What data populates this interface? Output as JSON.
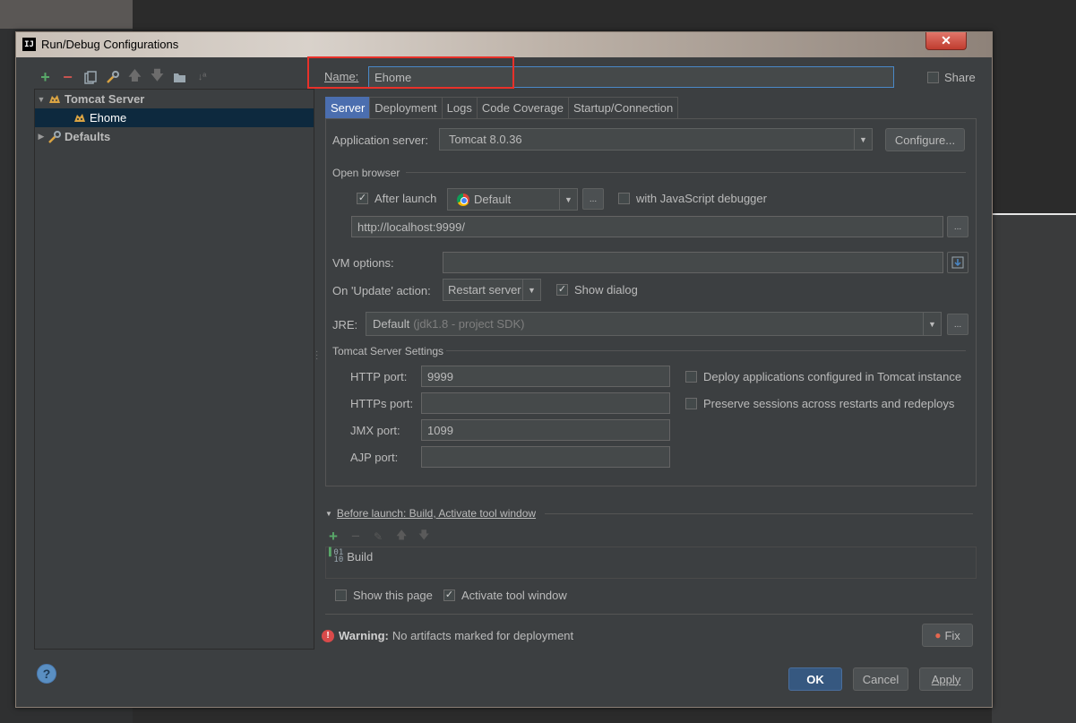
{
  "window": {
    "title": "Run/Debug Configurations",
    "close_label": "✕",
    "app_icon_label": "IJ"
  },
  "left_toolbar": {
    "icons": [
      "add-icon",
      "remove-icon",
      "copy-icon",
      "edit-defaults-icon",
      "move-up-icon",
      "move-down-icon",
      "folder-icon",
      "sort-icon"
    ]
  },
  "tree": {
    "items": [
      {
        "label": "Tomcat Server",
        "expanded": true
      },
      {
        "label": "Ehome",
        "selected": true
      },
      {
        "label": "Defaults",
        "expanded": false
      }
    ]
  },
  "name_field": {
    "label": "Name:",
    "value": "Ehome"
  },
  "share_label": "Share",
  "tabs": [
    "Server",
    "Deployment",
    "Logs",
    "Code Coverage",
    "Startup/Connection"
  ],
  "server": {
    "app_server_label": "Application server:",
    "app_server_value": "Tomcat 8.0.36",
    "configure_label": "Configure...",
    "open_browser_label": "Open browser",
    "after_launch_label": "After launch",
    "browser_value": "Default",
    "js_debugger_label": "with JavaScript debugger",
    "url_value": "http://localhost:9999/",
    "vm_options_label": "VM options:",
    "vm_options_value": "",
    "on_update_label": "On 'Update' action:",
    "on_update_value": "Restart server",
    "show_dialog_label": "Show dialog",
    "jre_label": "JRE:",
    "jre_value": "Default",
    "jre_hint": "(jdk1.8 - project SDK)",
    "tomcat_settings_label": "Tomcat Server Settings",
    "http_port_label": "HTTP port:",
    "http_port_value": "9999",
    "https_port_label": "HTTPs port:",
    "https_port_value": "",
    "jmx_port_label": "JMX port:",
    "jmx_port_value": "1099",
    "ajp_port_label": "AJP port:",
    "ajp_port_value": "",
    "deploy_apps_label": "Deploy applications configured in Tomcat instance",
    "preserve_sessions_label": "Preserve sessions across restarts and redeploys",
    "ellipsis": "..."
  },
  "before_launch": {
    "header": "Before launch: Build, Activate tool window",
    "items": [
      "Build"
    ],
    "show_page_label": "Show this page",
    "activate_tool_label": "Activate tool window"
  },
  "warning": {
    "bold": "Warning:",
    "text": "No artifacts marked for deployment",
    "fix_label": "Fix"
  },
  "footer": {
    "help_label": "?",
    "ok_label": "OK",
    "cancel_label": "Cancel",
    "apply_label": "Apply"
  },
  "colors": {
    "accent_tab": "#4b6eaf",
    "selection": "#0d293e",
    "highlight_box": "#e8312a",
    "add_green": "#59a869",
    "remove_red": "#c75450"
  }
}
